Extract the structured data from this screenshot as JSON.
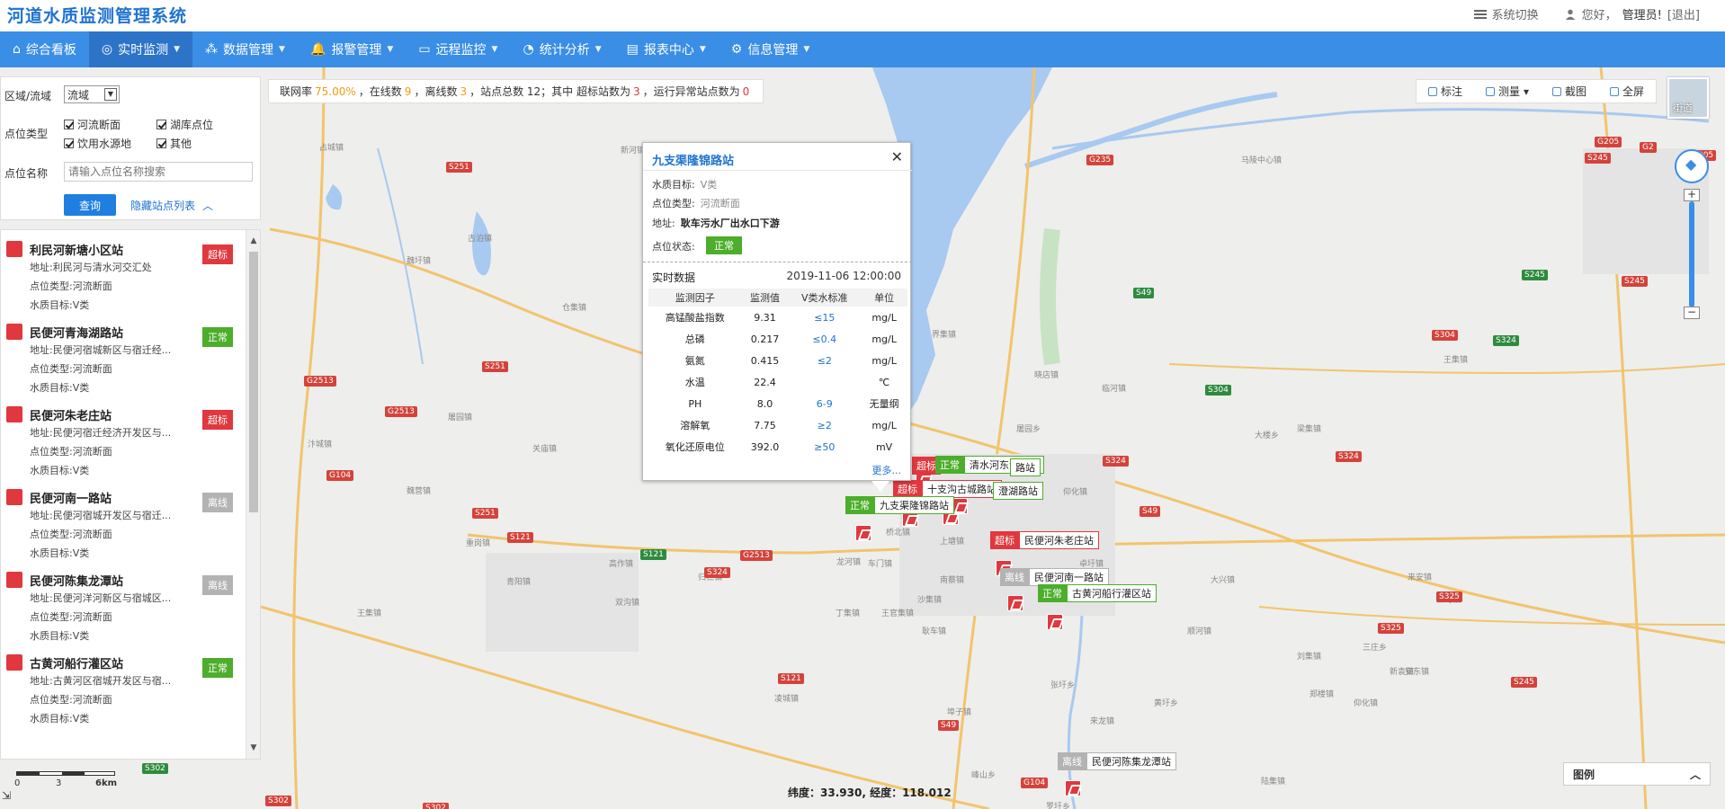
{
  "header": {
    "title": "河道水质监测管理系统",
    "system_switch": "系统切换",
    "greeting": "您好，",
    "user": "管理员!",
    "logout": "[退出]"
  },
  "nav": [
    {
      "label": "综合看板",
      "icon": "home-icon"
    },
    {
      "label": "实时监测",
      "icon": "globe-icon"
    },
    {
      "label": "数据管理",
      "icon": "data-icon"
    },
    {
      "label": "报警管理",
      "icon": "bell-icon"
    },
    {
      "label": "远程监控",
      "icon": "monitor-icon"
    },
    {
      "label": "统计分析",
      "icon": "pie-icon"
    },
    {
      "label": "报表中心",
      "icon": "report-icon"
    },
    {
      "label": "信息管理",
      "icon": "gear-icon"
    }
  ],
  "filter": {
    "region_label": "区域/流域",
    "region_value": "流域",
    "type_label": "点位类型",
    "types": [
      "河流断面",
      "湖库点位",
      "饮用水源地",
      "其他"
    ],
    "name_label": "点位名称",
    "name_placeholder": "请输入点位名称搜索",
    "query": "查询",
    "hide_list": "隐藏站点列表"
  },
  "stations": [
    {
      "name": "利民河新塘小区站",
      "address": "地址:利民河与清水河交汇处",
      "type": "点位类型:河流断面",
      "target": "水质目标:Ⅴ类",
      "status": "超标",
      "color": "red"
    },
    {
      "name": "民便河青海湖路站",
      "address": "地址:民便河宿城新区与宿迁经...",
      "type": "点位类型:河流断面",
      "target": "水质目标:Ⅴ类",
      "status": "正常",
      "color": "green"
    },
    {
      "name": "民便河朱老庄站",
      "address": "地址:民便河宿迁经济开发区与...",
      "type": "点位类型:河流断面",
      "target": "水质目标:Ⅴ类",
      "status": "超标",
      "color": "red"
    },
    {
      "name": "民便河南一路站",
      "address": "地址:民便河宿城开发区与宿迁...",
      "type": "点位类型:河流断面",
      "target": "水质目标:Ⅴ类",
      "status": "离线",
      "color": "gray"
    },
    {
      "name": "民便河陈集龙潭站",
      "address": "地址:民便河洋河新区与宿城区...",
      "type": "点位类型:河流断面",
      "target": "水质目标:Ⅴ类",
      "status": "离线",
      "color": "gray"
    },
    {
      "name": "古黄河船行灌区站",
      "address": "地址:古黄河区宿城开发区与宿...",
      "type": "点位类型:河流断面",
      "target": "水质目标:Ⅴ类",
      "status": "正常",
      "color": "green"
    }
  ],
  "stats": {
    "p1": "联网率",
    "rate": "75.00%",
    "p2": "，在线数",
    "online": "9",
    "p3": "，离线数",
    "offline": "3",
    "p4": "，站点总数 12；其中 超标站数为",
    "over": "3",
    "p5": "，运行异常站点数为",
    "abnormal": "0"
  },
  "tools": {
    "mark": "标注",
    "measure": "测量",
    "capture": "截图",
    "fullscreen": "全屏",
    "street": "街道"
  },
  "popup": {
    "title": "九支渠隆锦路站",
    "target_label": "水质目标:",
    "target": "Ⅴ类",
    "type_label": "点位类型:",
    "type": "河流断面",
    "address_label": "地址:",
    "address": "耿车污水厂出水口下游",
    "status_label": "点位状态:",
    "status": "正常",
    "realtime": "实时数据",
    "time": "2019-11-06 12:00:00",
    "headers": [
      "监测因子",
      "监测值",
      "Ⅴ类水标准",
      "单位"
    ],
    "rows": [
      [
        "高锰酸盐指数",
        "9.31",
        "≤15",
        "mg/L"
      ],
      [
        "总磷",
        "0.217",
        "≤0.4",
        "mg/L"
      ],
      [
        "氨氮",
        "0.415",
        "≤2",
        "mg/L"
      ],
      [
        "水温",
        "22.4",
        "",
        "℃"
      ],
      [
        "PH",
        "8.0",
        "6-9",
        "无量纲"
      ],
      [
        "溶解氧",
        "7.75",
        "≥2",
        "mg/L"
      ],
      [
        "氧化还原电位",
        "392.0",
        "≥50",
        "mV"
      ]
    ],
    "more": "更多..."
  },
  "markers": [
    {
      "tag": "超标",
      "name": "",
      "color": "red"
    },
    {
      "tag": "正常",
      "name": "清水河东海路站",
      "color": "green"
    },
    {
      "tag": "",
      "name": "路站",
      "color": "green"
    },
    {
      "tag": "超标",
      "name": "十支沟古城路站",
      "color": "red"
    },
    {
      "tag": "",
      "name": "澄湖路站",
      "color": "green"
    },
    {
      "tag": "正常",
      "name": "九支渠隆锦路站",
      "color": "green"
    },
    {
      "tag": "超标",
      "name": "民便河朱老庄站",
      "color": "red"
    },
    {
      "tag": "离线",
      "name": "民便河南一路站",
      "color": "gray"
    },
    {
      "tag": "正常",
      "name": "古黄河船行灌区站",
      "color": "green"
    },
    {
      "tag": "离线",
      "name": "民便河陈集龙潭站",
      "color": "gray"
    }
  ],
  "legend": "图例",
  "coord": {
    "lat_label": "纬度：",
    "lat": "33.930",
    "lon_label": ", 经度：",
    "lon": "118.012"
  },
  "scale": {
    "t0": "0",
    "t1": "3",
    "t2": "6km"
  },
  "towns": [
    "占城镇",
    "新河镇",
    "魏圩镇",
    "仓集镇",
    "屠园镇",
    "关庙镇",
    "重岗镇",
    "青阳镇",
    "古泊镇",
    "界集镇",
    "王集镇",
    "汴城镇",
    "魏营镇",
    "高作镇",
    "双沟镇",
    "归仁镇",
    "龙河镇",
    "车门镇",
    "桥北镇",
    "上塘镇",
    "南蔡镇",
    "卓圩镇",
    "王官集镇",
    "大兴镇",
    "顺河镇",
    "仰化镇",
    "耿车镇",
    "洋北镇",
    "罗圩乡",
    "埠子镇",
    "峰山乡",
    "张圩乡",
    "来龙镇",
    "沙集镇",
    "凌城镇",
    "丁集镇",
    "三庄乡",
    "刘集镇",
    "新袁镇",
    "梁集镇",
    "王集乡",
    "黄圩乡",
    "陆集镇",
    "郑楼镇",
    "安东镇",
    "来安镇",
    "五河镇",
    "王集镇",
    "马陵中心镇",
    "大楼乡",
    "临河镇",
    "晓店镇",
    "屠园乡",
    "仰化镇"
  ],
  "roads": [
    "S251",
    "S251",
    "S251",
    "G2513",
    "G2513",
    "G104",
    "S251",
    "G235",
    "S304",
    "S304",
    "S324",
    "S324",
    "S324",
    "G205",
    "S245",
    "S245",
    "S245",
    "S325",
    "S325",
    "S245",
    "S49",
    "S49",
    "G104",
    "S121",
    "S121",
    "G2513",
    "S324",
    "S121",
    "S302",
    "S302",
    "S302",
    "G205",
    "G2",
    "S49"
  ]
}
